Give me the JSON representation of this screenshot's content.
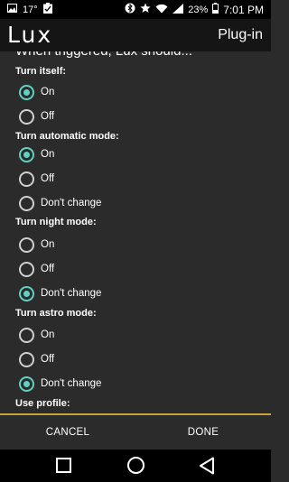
{
  "status_bar": {
    "temp": "17°",
    "battery_pct": "23%",
    "time": "7:01 PM",
    "icons": [
      "image-icon",
      "clipboard-icon",
      "bluetooth-icon",
      "star-icon",
      "wifi-icon",
      "signal-icon",
      "battery-icon"
    ]
  },
  "app_bar": {
    "title": "Lux",
    "action": "Plug-in"
  },
  "intro": "When triggered, Lux should...",
  "sections": [
    {
      "label": "Turn itself:",
      "options": [
        "On",
        "Off"
      ],
      "selected": "On"
    },
    {
      "label": "Turn automatic mode:",
      "options": [
        "On",
        "Off",
        "Don't change"
      ],
      "selected": "On"
    },
    {
      "label": "Turn night mode:",
      "options": [
        "On",
        "Off",
        "Don't change"
      ],
      "selected": "Don't change"
    },
    {
      "label": "Turn astro mode:",
      "options": [
        "On",
        "Off",
        "Don't change"
      ],
      "selected": "Don't change"
    },
    {
      "label": "Use profile:",
      "options": [],
      "selected": ""
    }
  ],
  "buttons": {
    "cancel": "CANCEL",
    "done": "DONE"
  },
  "colors": {
    "accent": "#5fd1c0",
    "divider": "#c8a23a"
  }
}
